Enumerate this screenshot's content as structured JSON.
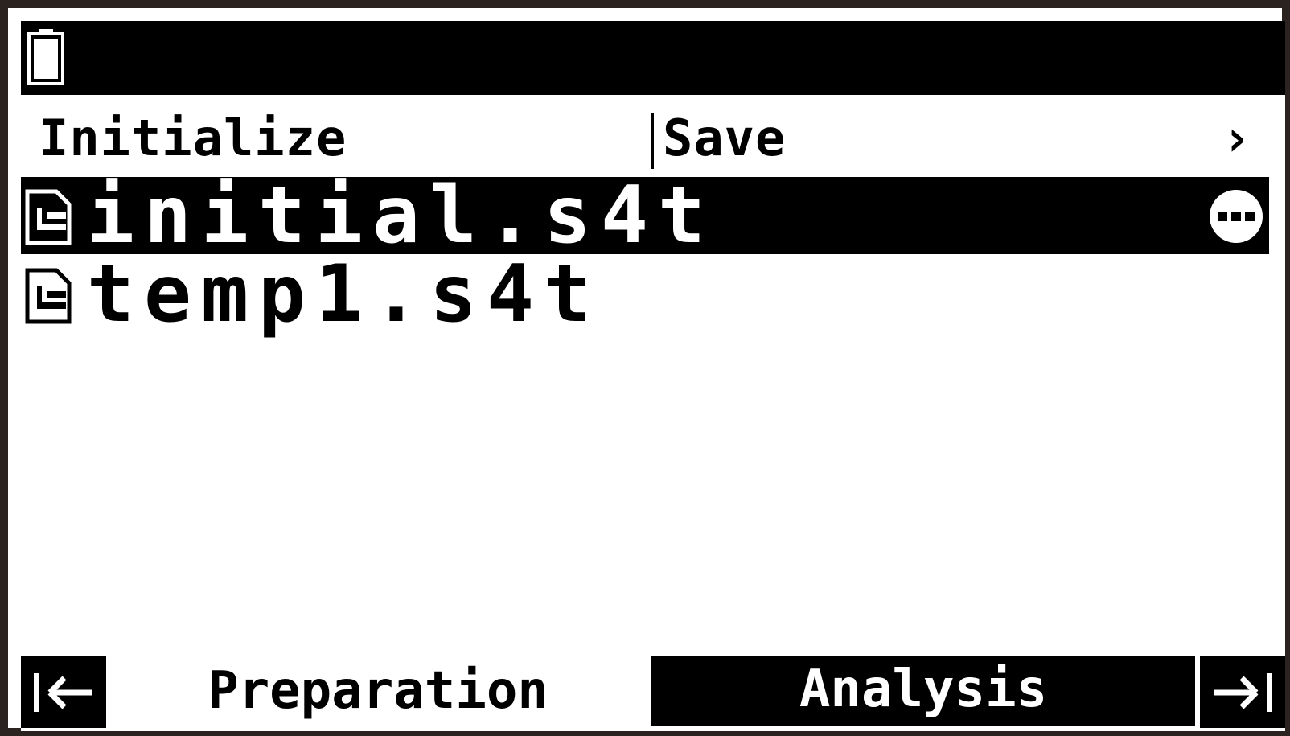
{
  "status_bar": {
    "icons": [
      "battery-icon"
    ]
  },
  "function_keys": {
    "items": [
      {
        "label": "Initialize"
      },
      {
        "label": "Save"
      }
    ],
    "more_label": "›"
  },
  "files": [
    {
      "name": "initial.s4t",
      "icon": "file-icon",
      "selected": true,
      "options_icon": "more-options-icon"
    },
    {
      "name": "temp1.s4t",
      "icon": "file-icon",
      "selected": false
    }
  ],
  "tabs": {
    "scroll_left_icon": "scroll-left-icon",
    "scroll_right_icon": "scroll-right-icon",
    "items": [
      {
        "label": "Preparation",
        "active": true
      },
      {
        "label": "Analysis",
        "active": false
      }
    ]
  }
}
